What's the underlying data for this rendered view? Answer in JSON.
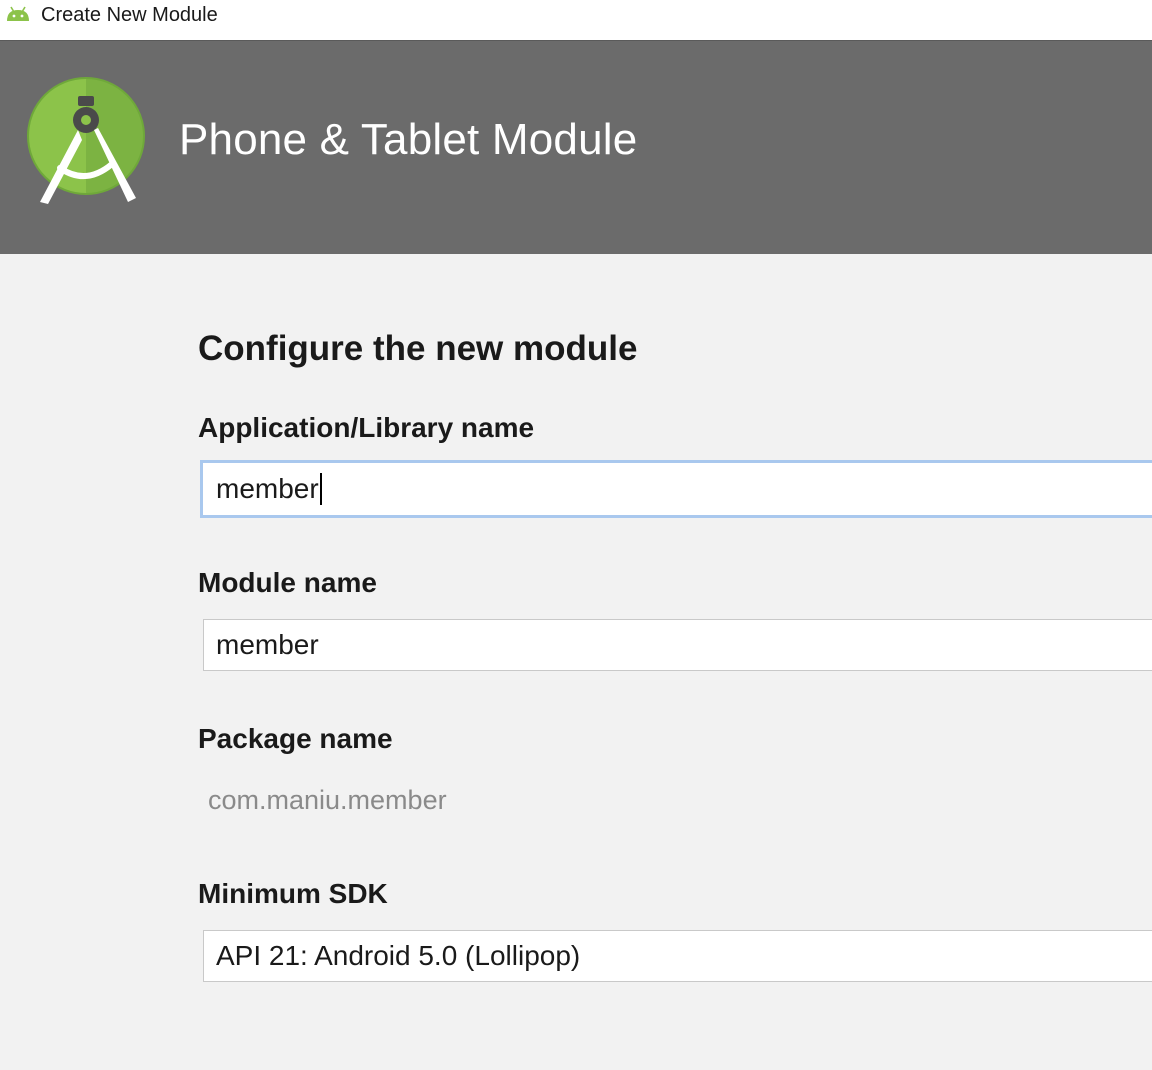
{
  "window": {
    "title": "Create New Module"
  },
  "banner": {
    "title": "Phone & Tablet Module"
  },
  "form": {
    "heading": "Configure the new module",
    "app_name": {
      "label": "Application/Library name",
      "value": "member"
    },
    "module_name": {
      "label": "Module name",
      "value": "member"
    },
    "package_name": {
      "label": "Package name",
      "value": "com.maniu.member"
    },
    "min_sdk": {
      "label": "Minimum SDK",
      "value": "API 21: Android 5.0 (Lollipop)"
    }
  },
  "colors": {
    "banner_bg": "#6b6b6b",
    "android_green": "#8cc34a",
    "focus_border": "#a9c8ee"
  }
}
